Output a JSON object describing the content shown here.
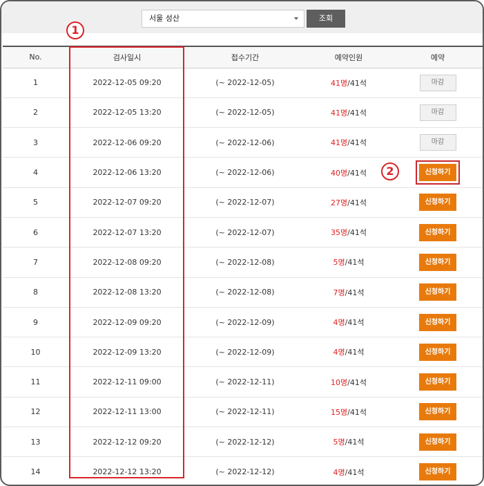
{
  "search": {
    "location_value": "서울 성산",
    "button_label": "조회"
  },
  "table": {
    "headers": [
      "No.",
      "검사일시",
      "접수기간",
      "예약인원",
      "예약"
    ],
    "rows": [
      {
        "no": "1",
        "datetime": "2022-12-05 09:20",
        "period": "(~ 2022-12-05)",
        "booked": "41명",
        "capacity": "/41석",
        "action": "마감",
        "status": "closed"
      },
      {
        "no": "2",
        "datetime": "2022-12-05 13:20",
        "period": "(~ 2022-12-05)",
        "booked": "41명",
        "capacity": "/41석",
        "action": "마감",
        "status": "closed"
      },
      {
        "no": "3",
        "datetime": "2022-12-06 09:20",
        "period": "(~ 2022-12-06)",
        "booked": "41명",
        "capacity": "/41석",
        "action": "마감",
        "status": "closed"
      },
      {
        "no": "4",
        "datetime": "2022-12-06 13:20",
        "period": "(~ 2022-12-06)",
        "booked": "40명",
        "capacity": "/41석",
        "action": "신청하기",
        "status": "open",
        "highlight": true
      },
      {
        "no": "5",
        "datetime": "2022-12-07 09:20",
        "period": "(~ 2022-12-07)",
        "booked": "27명",
        "capacity": "/41석",
        "action": "신청하기",
        "status": "open"
      },
      {
        "no": "6",
        "datetime": "2022-12-07 13:20",
        "period": "(~ 2022-12-07)",
        "booked": "35명",
        "capacity": "/41석",
        "action": "신청하기",
        "status": "open"
      },
      {
        "no": "7",
        "datetime": "2022-12-08 09:20",
        "period": "(~ 2022-12-08)",
        "booked": "5명",
        "capacity": "/41석",
        "action": "신청하기",
        "status": "open"
      },
      {
        "no": "8",
        "datetime": "2022-12-08 13:20",
        "period": "(~ 2022-12-08)",
        "booked": "7명",
        "capacity": "/41석",
        "action": "신청하기",
        "status": "open"
      },
      {
        "no": "9",
        "datetime": "2022-12-09 09:20",
        "period": "(~ 2022-12-09)",
        "booked": "4명",
        "capacity": "/41석",
        "action": "신청하기",
        "status": "open"
      },
      {
        "no": "10",
        "datetime": "2022-12-09 13:20",
        "period": "(~ 2022-12-09)",
        "booked": "4명",
        "capacity": "/41석",
        "action": "신청하기",
        "status": "open"
      },
      {
        "no": "11",
        "datetime": "2022-12-11 09:00",
        "period": "(~ 2022-12-11)",
        "booked": "10명",
        "capacity": "/41석",
        "action": "신청하기",
        "status": "open"
      },
      {
        "no": "12",
        "datetime": "2022-12-11 13:00",
        "period": "(~ 2022-12-11)",
        "booked": "15명",
        "capacity": "/41석",
        "action": "신청하기",
        "status": "open"
      },
      {
        "no": "13",
        "datetime": "2022-12-12 09:20",
        "period": "(~ 2022-12-12)",
        "booked": "5명",
        "capacity": "/41석",
        "action": "신청하기",
        "status": "open"
      },
      {
        "no": "14",
        "datetime": "2022-12-12 13:20",
        "period": "(~ 2022-12-12)",
        "booked": "4명",
        "capacity": "/41석",
        "action": "신청하기",
        "status": "open"
      }
    ]
  },
  "annotations": {
    "marker_1": "1",
    "marker_2": "2"
  },
  "colors": {
    "accent_orange": "#e87a0c",
    "booked_red": "#e02020",
    "annotation_red": "#d8232a"
  }
}
